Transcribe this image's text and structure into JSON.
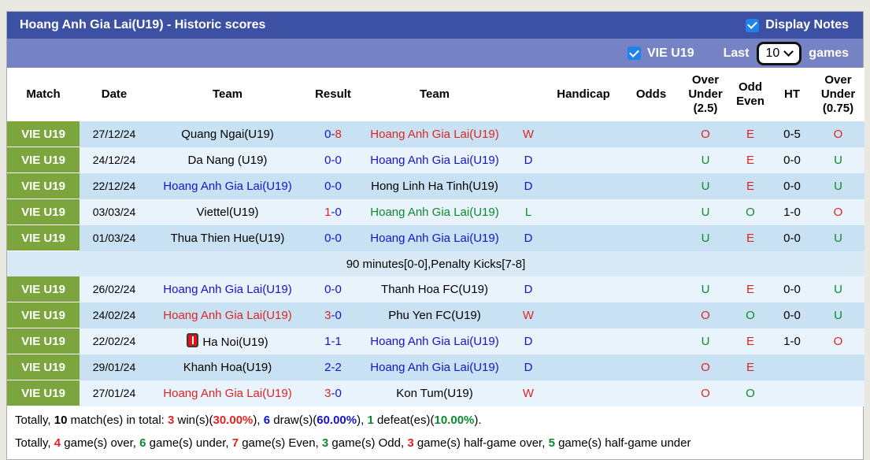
{
  "colors": {
    "red": "#e02424",
    "blue": "#1414cc",
    "green": "#0c8a2c",
    "black": "#000000"
  },
  "header": {
    "title": "Hoang Anh Gia Lai(U19) - Historic scores",
    "display_notes_label": "Display Notes",
    "league_label": "VIE U19",
    "last_label": "Last",
    "games_count": "10",
    "games_label": "games"
  },
  "table": {
    "columns": [
      "Match",
      "Date",
      "Team",
      "Result",
      "Team",
      "",
      "Handicap",
      "Odds",
      "Over\nUnder\n(2.5)",
      "Odd\nEven",
      "HT",
      "Over\nUnder\n(0.75)"
    ],
    "rows": [
      {
        "badge": "VIE U19",
        "date": "27/12/24",
        "home": {
          "text": "Quang Ngai(U19)",
          "color": "black"
        },
        "score": {
          "home": "0",
          "home_color": "blue",
          "away": "8",
          "away_color": "red"
        },
        "away": {
          "text": "Hoang Anh Gia Lai(U19)",
          "color": "red"
        },
        "outcome": {
          "text": "W",
          "color": "red"
        },
        "handicap": "",
        "odds": "",
        "ou25": {
          "text": "O",
          "color": "red"
        },
        "odd_even": {
          "text": "E",
          "color": "red"
        },
        "ht": "0-5",
        "ou075": {
          "text": "O",
          "color": "red"
        }
      },
      {
        "badge": "VIE U19",
        "date": "24/12/24",
        "home": {
          "text": "Da Nang (U19)",
          "color": "black"
        },
        "score": {
          "home": "0",
          "home_color": "blue",
          "away": "0",
          "away_color": "blue"
        },
        "away": {
          "text": "Hoang Anh Gia Lai(U19)",
          "color": "blue"
        },
        "outcome": {
          "text": "D",
          "color": "blue"
        },
        "handicap": "",
        "odds": "",
        "ou25": {
          "text": "U",
          "color": "green"
        },
        "odd_even": {
          "text": "E",
          "color": "red"
        },
        "ht": "0-0",
        "ou075": {
          "text": "U",
          "color": "green"
        }
      },
      {
        "badge": "VIE U19",
        "date": "22/12/24",
        "home": {
          "text": "Hoang Anh Gia Lai(U19)",
          "color": "blue"
        },
        "score": {
          "home": "0",
          "home_color": "blue",
          "away": "0",
          "away_color": "blue"
        },
        "away": {
          "text": "Hong Linh Ha Tinh(U19)",
          "color": "black"
        },
        "outcome": {
          "text": "D",
          "color": "blue"
        },
        "handicap": "",
        "odds": "",
        "ou25": {
          "text": "U",
          "color": "green"
        },
        "odd_even": {
          "text": "E",
          "color": "red"
        },
        "ht": "0-0",
        "ou075": {
          "text": "U",
          "color": "green"
        }
      },
      {
        "badge": "VIE U19",
        "date": "03/03/24",
        "home": {
          "text": "Viettel(U19)",
          "color": "black"
        },
        "score": {
          "home": "1",
          "home_color": "red",
          "away": "0",
          "away_color": "blue"
        },
        "away": {
          "text": "Hoang Anh Gia Lai(U19)",
          "color": "green"
        },
        "outcome": {
          "text": "L",
          "color": "green"
        },
        "handicap": "",
        "odds": "",
        "ou25": {
          "text": "U",
          "color": "green"
        },
        "odd_even": {
          "text": "O",
          "color": "green"
        },
        "ht": "1-0",
        "ou075": {
          "text": "O",
          "color": "red"
        }
      },
      {
        "badge": "VIE U19",
        "date": "01/03/24",
        "home": {
          "text": "Thua Thien Hue(U19)",
          "color": "black"
        },
        "score": {
          "home": "0",
          "home_color": "blue",
          "away": "0",
          "away_color": "blue"
        },
        "away": {
          "text": "Hoang Anh Gia Lai(U19)",
          "color": "blue"
        },
        "outcome": {
          "text": "D",
          "color": "blue"
        },
        "handicap": "",
        "odds": "",
        "ou25": {
          "text": "U",
          "color": "green"
        },
        "odd_even": {
          "text": "E",
          "color": "red"
        },
        "ht": "0-0",
        "ou075": {
          "text": "U",
          "color": "green"
        }
      },
      {
        "note": "90 minutes[0-0],Penalty Kicks[7-8]"
      },
      {
        "badge": "VIE U19",
        "date": "26/02/24",
        "home": {
          "text": "Hoang Anh Gia Lai(U19)",
          "color": "blue"
        },
        "score": {
          "home": "0",
          "home_color": "blue",
          "away": "0",
          "away_color": "blue"
        },
        "away": {
          "text": "Thanh Hoa FC(U19)",
          "color": "black"
        },
        "outcome": {
          "text": "D",
          "color": "blue"
        },
        "handicap": "",
        "odds": "",
        "ou25": {
          "text": "U",
          "color": "green"
        },
        "odd_even": {
          "text": "E",
          "color": "red"
        },
        "ht": "0-0",
        "ou075": {
          "text": "U",
          "color": "green"
        }
      },
      {
        "badge": "VIE U19",
        "date": "24/02/24",
        "home": {
          "text": "Hoang Anh Gia Lai(U19)",
          "color": "red"
        },
        "score": {
          "home": "3",
          "home_color": "red",
          "away": "0",
          "away_color": "blue"
        },
        "away": {
          "text": "Phu Yen FC(U19)",
          "color": "black"
        },
        "outcome": {
          "text": "W",
          "color": "red"
        },
        "handicap": "",
        "odds": "",
        "ou25": {
          "text": "O",
          "color": "red"
        },
        "odd_even": {
          "text": "O",
          "color": "green"
        },
        "ht": "0-0",
        "ou075": {
          "text": "U",
          "color": "green"
        }
      },
      {
        "badge": "VIE U19",
        "date": "22/02/24",
        "home": {
          "text": "Ha Noi(U19)",
          "color": "black",
          "icon": "red-card"
        },
        "score": {
          "home": "1",
          "home_color": "blue",
          "away": "1",
          "away_color": "blue"
        },
        "away": {
          "text": "Hoang Anh Gia Lai(U19)",
          "color": "blue"
        },
        "outcome": {
          "text": "D",
          "color": "blue"
        },
        "handicap": "",
        "odds": "",
        "ou25": {
          "text": "U",
          "color": "green"
        },
        "odd_even": {
          "text": "E",
          "color": "red"
        },
        "ht": "1-0",
        "ou075": {
          "text": "O",
          "color": "red"
        }
      },
      {
        "badge": "VIE U19",
        "date": "29/01/24",
        "home": {
          "text": "Khanh Hoa(U19)",
          "color": "black"
        },
        "score": {
          "home": "2",
          "home_color": "blue",
          "away": "2",
          "away_color": "blue"
        },
        "away": {
          "text": "Hoang Anh Gia Lai(U19)",
          "color": "blue"
        },
        "outcome": {
          "text": "D",
          "color": "blue"
        },
        "handicap": "",
        "odds": "",
        "ou25": {
          "text": "O",
          "color": "red"
        },
        "odd_even": {
          "text": "E",
          "color": "red"
        },
        "ht": "",
        "ou075": {
          "text": "",
          "color": "black"
        }
      },
      {
        "badge": "VIE U19",
        "date": "27/01/24",
        "home": {
          "text": "Hoang Anh Gia Lai(U19)",
          "color": "red"
        },
        "score": {
          "home": "3",
          "home_color": "red",
          "away": "0",
          "away_color": "blue"
        },
        "away": {
          "text": "Kon Tum(U19)",
          "color": "black"
        },
        "outcome": {
          "text": "W",
          "color": "red"
        },
        "handicap": "",
        "odds": "",
        "ou25": {
          "text": "O",
          "color": "red"
        },
        "odd_even": {
          "text": "O",
          "color": "green"
        },
        "ht": "",
        "ou075": {
          "text": "",
          "color": "black"
        }
      }
    ]
  },
  "summary": {
    "line1": [
      {
        "t": "Totally, "
      },
      {
        "t": "10",
        "b": 1
      },
      {
        "t": " match(es) in total: "
      },
      {
        "t": "3",
        "b": 1,
        "c": "red"
      },
      {
        "t": " win(s)("
      },
      {
        "t": "30.00%",
        "b": 1,
        "c": "red"
      },
      {
        "t": "), "
      },
      {
        "t": "6",
        "b": 1,
        "c": "blue"
      },
      {
        "t": " draw(s)("
      },
      {
        "t": "60.00%",
        "b": 1,
        "c": "blue"
      },
      {
        "t": "), "
      },
      {
        "t": "1",
        "b": 1,
        "c": "green"
      },
      {
        "t": " defeat(es)("
      },
      {
        "t": "10.00%",
        "b": 1,
        "c": "green"
      },
      {
        "t": ")."
      }
    ],
    "line2": [
      {
        "t": "Totally, "
      },
      {
        "t": "4",
        "b": 1,
        "c": "red"
      },
      {
        "t": " game(s) over, "
      },
      {
        "t": "6",
        "b": 1,
        "c": "green"
      },
      {
        "t": " game(s) under, "
      },
      {
        "t": "7",
        "b": 1,
        "c": "red"
      },
      {
        "t": " game(s) Even, "
      },
      {
        "t": "3",
        "b": 1,
        "c": "green"
      },
      {
        "t": " game(s) Odd, "
      },
      {
        "t": "3",
        "b": 1,
        "c": "red"
      },
      {
        "t": " game(s) half-game over, "
      },
      {
        "t": "5",
        "b": 1,
        "c": "green"
      },
      {
        "t": " game(s) half-game under"
      }
    ]
  }
}
